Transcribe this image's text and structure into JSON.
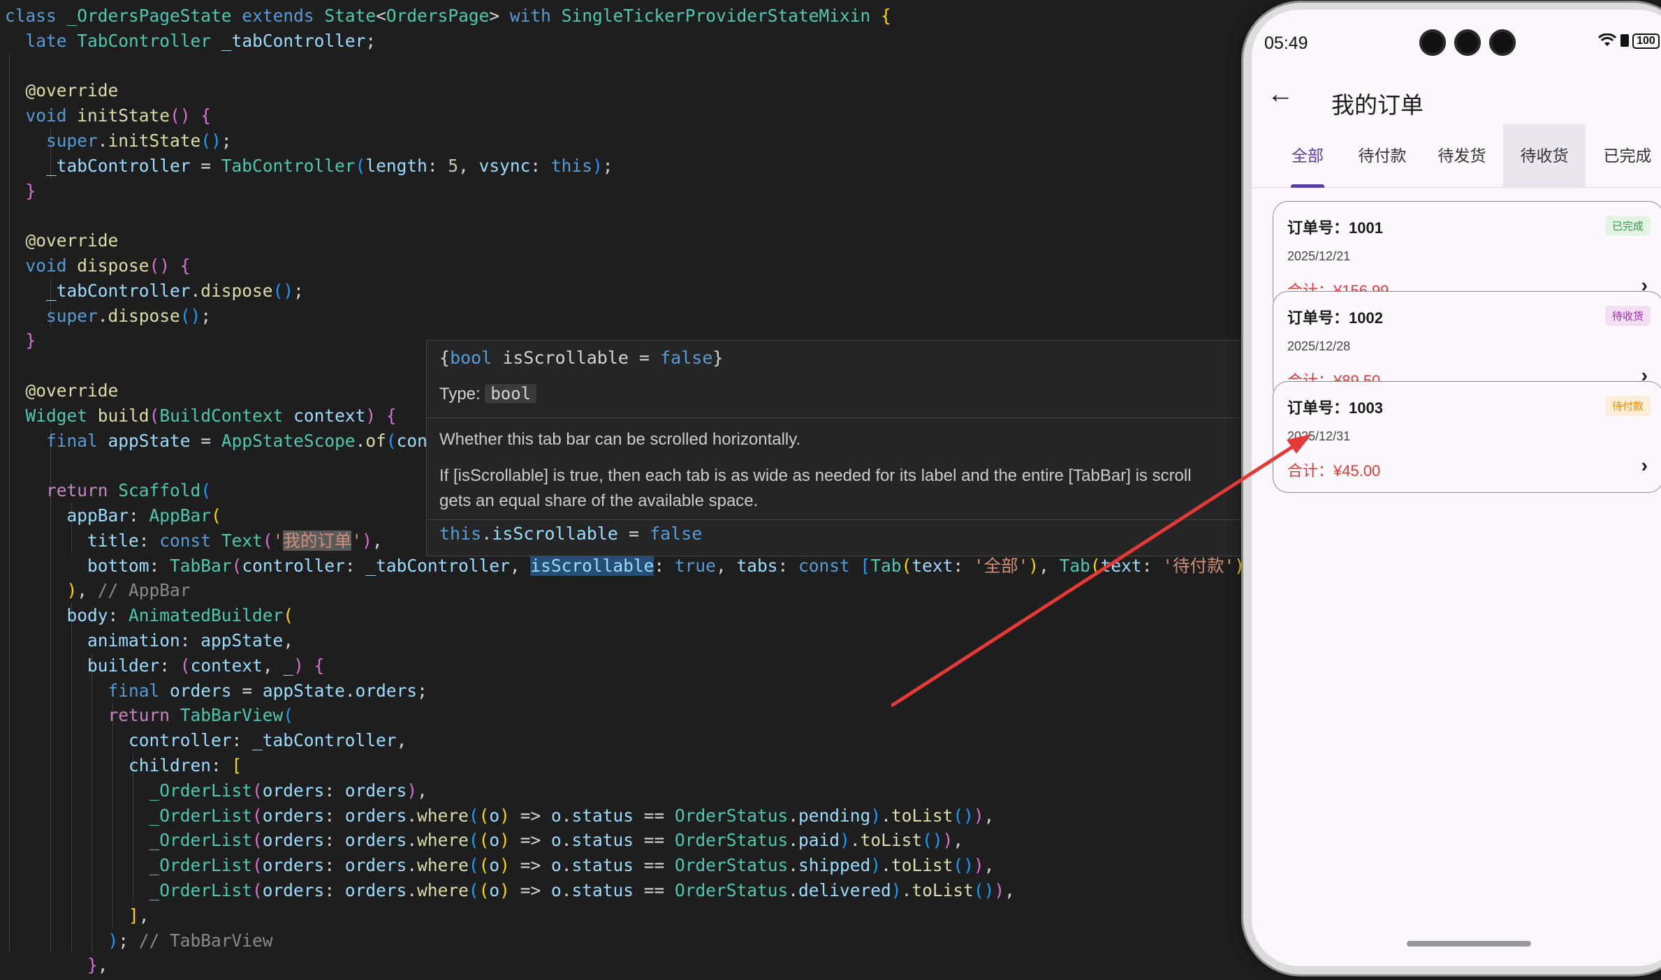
{
  "code_lines": [
    {
      "indent": "",
      "tokens": [
        [
          "kw",
          "class"
        ],
        [
          "pu",
          " "
        ],
        [
          "ty",
          "_OrdersPageState"
        ],
        [
          "pu",
          " "
        ],
        [
          "kw",
          "extends"
        ],
        [
          "pu",
          " "
        ],
        [
          "ty",
          "State"
        ],
        [
          "pu",
          "<"
        ],
        [
          "ty",
          "OrdersPage"
        ],
        [
          "pu",
          "> "
        ],
        [
          "kw",
          "with"
        ],
        [
          "pu",
          " "
        ],
        [
          "ty",
          "SingleTickerProviderStateMixin"
        ],
        [
          "pu",
          " "
        ],
        [
          "b1",
          "{"
        ]
      ]
    },
    {
      "indent": "  ",
      "tokens": [
        [
          "kw",
          "late"
        ],
        [
          "pu",
          " "
        ],
        [
          "ty",
          "TabController"
        ],
        [
          "pu",
          " "
        ],
        [
          "va",
          "_tabController"
        ],
        [
          "pu",
          ";"
        ]
      ]
    },
    {
      "indent": "",
      "tokens": []
    },
    {
      "indent": "  ",
      "tokens": [
        [
          "fn",
          "@override"
        ]
      ]
    },
    {
      "indent": "  ",
      "tokens": [
        [
          "kw",
          "void"
        ],
        [
          "pu",
          " "
        ],
        [
          "fn",
          "initState"
        ],
        [
          "b2",
          "()"
        ],
        [
          "pu",
          " "
        ],
        [
          "b2",
          "{"
        ]
      ]
    },
    {
      "indent": "    ",
      "tokens": [
        [
          "kw",
          "super"
        ],
        [
          "pu",
          "."
        ],
        [
          "fn",
          "initState"
        ],
        [
          "b3",
          "()"
        ],
        [
          "pu",
          ";"
        ]
      ]
    },
    {
      "indent": "    ",
      "tokens": [
        [
          "va",
          "_tabController"
        ],
        [
          "pu",
          " = "
        ],
        [
          "ty",
          "TabController"
        ],
        [
          "b3",
          "("
        ],
        [
          "va",
          "length"
        ],
        [
          "pu",
          ": "
        ],
        [
          "nu",
          "5"
        ],
        [
          "pu",
          ", "
        ],
        [
          "va",
          "vsync"
        ],
        [
          "pu",
          ": "
        ],
        [
          "kw",
          "this"
        ],
        [
          "b3",
          ")"
        ],
        [
          "pu",
          ";"
        ]
      ]
    },
    {
      "indent": "  ",
      "tokens": [
        [
          "b2",
          "}"
        ]
      ]
    },
    {
      "indent": "",
      "tokens": []
    },
    {
      "indent": "  ",
      "tokens": [
        [
          "fn",
          "@override"
        ]
      ]
    },
    {
      "indent": "  ",
      "tokens": [
        [
          "kw",
          "void"
        ],
        [
          "pu",
          " "
        ],
        [
          "fn",
          "dispose"
        ],
        [
          "b2",
          "()"
        ],
        [
          "pu",
          " "
        ],
        [
          "b2",
          "{"
        ]
      ]
    },
    {
      "indent": "    ",
      "tokens": [
        [
          "va",
          "_tabController"
        ],
        [
          "pu",
          "."
        ],
        [
          "fn",
          "dispose"
        ],
        [
          "b3",
          "()"
        ],
        [
          "pu",
          ";"
        ]
      ]
    },
    {
      "indent": "    ",
      "tokens": [
        [
          "kw",
          "super"
        ],
        [
          "pu",
          "."
        ],
        [
          "fn",
          "dispose"
        ],
        [
          "b3",
          "()"
        ],
        [
          "pu",
          ";"
        ]
      ]
    },
    {
      "indent": "  ",
      "tokens": [
        [
          "b2",
          "}"
        ]
      ]
    },
    {
      "indent": "",
      "tokens": []
    },
    {
      "indent": "  ",
      "tokens": [
        [
          "fn",
          "@override"
        ]
      ]
    },
    {
      "indent": "  ",
      "tokens": [
        [
          "ty",
          "Widget"
        ],
        [
          "pu",
          " "
        ],
        [
          "fn",
          "build"
        ],
        [
          "b2",
          "("
        ],
        [
          "ty",
          "BuildContext"
        ],
        [
          "pu",
          " "
        ],
        [
          "va",
          "context"
        ],
        [
          "b2",
          ")"
        ],
        [
          "pu",
          " "
        ],
        [
          "b2",
          "{"
        ]
      ]
    },
    {
      "indent": "    ",
      "tokens": [
        [
          "kw",
          "final"
        ],
        [
          "pu",
          " "
        ],
        [
          "va",
          "appState"
        ],
        [
          "pu",
          " = "
        ],
        [
          "ty",
          "AppStateScope"
        ],
        [
          "pu",
          "."
        ],
        [
          "fn",
          "of"
        ],
        [
          "b3",
          "("
        ],
        [
          "va",
          "cont"
        ]
      ]
    },
    {
      "indent": "",
      "tokens": []
    },
    {
      "indent": "    ",
      "tokens": [
        [
          "kw2",
          "return"
        ],
        [
          "pu",
          " "
        ],
        [
          "ty",
          "Scaffold"
        ],
        [
          "b3",
          "("
        ]
      ]
    },
    {
      "indent": "      ",
      "tokens": [
        [
          "va",
          "appBar"
        ],
        [
          "pu",
          ": "
        ],
        [
          "ty",
          "AppBar"
        ],
        [
          "b1",
          "("
        ]
      ]
    },
    {
      "indent": "        ",
      "tokens": [
        [
          "va",
          "title"
        ],
        [
          "pu",
          ": "
        ],
        [
          "kw",
          "const"
        ],
        [
          "pu",
          " "
        ],
        [
          "ty",
          "Text"
        ],
        [
          "b2",
          "("
        ],
        [
          "st",
          "'"
        ],
        [
          "st hl",
          "我的订单"
        ],
        [
          "st",
          "'"
        ],
        [
          "b2",
          ")"
        ],
        [
          "pu",
          ","
        ]
      ]
    },
    {
      "indent": "        ",
      "tokens": [
        [
          "va",
          "bottom"
        ],
        [
          "pu",
          ": "
        ],
        [
          "ty",
          "TabBar"
        ],
        [
          "b2",
          "("
        ],
        [
          "va",
          "controller"
        ],
        [
          "pu",
          ": "
        ],
        [
          "va",
          "_tabController"
        ],
        [
          "pu",
          ", "
        ],
        [
          "va hl2",
          "isScrollable"
        ],
        [
          "pu",
          ": "
        ],
        [
          "kw",
          "true"
        ],
        [
          "pu",
          ", "
        ],
        [
          "va",
          "tabs"
        ],
        [
          "pu",
          ": "
        ],
        [
          "kw",
          "const"
        ],
        [
          "pu",
          " "
        ],
        [
          "b3",
          "["
        ],
        [
          "ty",
          "Tab"
        ],
        [
          "b1",
          "("
        ],
        [
          "va",
          "text"
        ],
        [
          "pu",
          ": "
        ],
        [
          "st",
          "'全部'"
        ],
        [
          "b1",
          ")"
        ],
        [
          "pu",
          ", "
        ],
        [
          "ty",
          "Tab"
        ],
        [
          "b1",
          "("
        ],
        [
          "va",
          "text"
        ],
        [
          "pu",
          ": "
        ],
        [
          "st",
          "'待付款'"
        ],
        [
          "b1",
          ")"
        ],
        [
          "pu",
          ", "
        ]
      ]
    },
    {
      "indent": "      ",
      "tokens": [
        [
          "b1",
          ")"
        ],
        [
          "pu",
          ", "
        ],
        [
          "cm",
          "// AppBar"
        ]
      ]
    },
    {
      "indent": "      ",
      "tokens": [
        [
          "va",
          "body"
        ],
        [
          "pu",
          ": "
        ],
        [
          "ty",
          "AnimatedBuilder"
        ],
        [
          "b1",
          "("
        ]
      ]
    },
    {
      "indent": "        ",
      "tokens": [
        [
          "va",
          "animation"
        ],
        [
          "pu",
          ": "
        ],
        [
          "va",
          "appState"
        ],
        [
          "pu",
          ","
        ]
      ]
    },
    {
      "indent": "        ",
      "tokens": [
        [
          "va",
          "builder"
        ],
        [
          "pu",
          ": "
        ],
        [
          "b2",
          "("
        ],
        [
          "va",
          "context"
        ],
        [
          "pu",
          ", "
        ],
        [
          "va",
          "_"
        ],
        [
          "b2",
          ")"
        ],
        [
          "pu",
          " "
        ],
        [
          "b2",
          "{"
        ]
      ]
    },
    {
      "indent": "          ",
      "tokens": [
        [
          "kw",
          "final"
        ],
        [
          "pu",
          " "
        ],
        [
          "va",
          "orders"
        ],
        [
          "pu",
          " = "
        ],
        [
          "va",
          "appState"
        ],
        [
          "pu",
          "."
        ],
        [
          "va",
          "orders"
        ],
        [
          "pu",
          ";"
        ]
      ]
    },
    {
      "indent": "          ",
      "tokens": [
        [
          "kw2",
          "return"
        ],
        [
          "pu",
          " "
        ],
        [
          "ty",
          "TabBarView"
        ],
        [
          "b3",
          "("
        ]
      ]
    },
    {
      "indent": "            ",
      "tokens": [
        [
          "va",
          "controller"
        ],
        [
          "pu",
          ": "
        ],
        [
          "va",
          "_tabController"
        ],
        [
          "pu",
          ","
        ]
      ]
    },
    {
      "indent": "            ",
      "tokens": [
        [
          "va",
          "children"
        ],
        [
          "pu",
          ": "
        ],
        [
          "b1",
          "["
        ]
      ]
    },
    {
      "indent": "              ",
      "tokens": [
        [
          "ty",
          "_OrderList"
        ],
        [
          "b2",
          "("
        ],
        [
          "va",
          "orders"
        ],
        [
          "pu",
          ": "
        ],
        [
          "va",
          "orders"
        ],
        [
          "b2",
          ")"
        ],
        [
          "pu",
          ","
        ]
      ]
    },
    {
      "indent": "              ",
      "tokens": [
        [
          "ty",
          "_OrderList"
        ],
        [
          "b2",
          "("
        ],
        [
          "va",
          "orders"
        ],
        [
          "pu",
          ": "
        ],
        [
          "va",
          "orders"
        ],
        [
          "pu",
          "."
        ],
        [
          "fn",
          "where"
        ],
        [
          "b3",
          "("
        ],
        [
          "b1",
          "("
        ],
        [
          "va",
          "o"
        ],
        [
          "b1",
          ")"
        ],
        [
          "pu",
          " => "
        ],
        [
          "va",
          "o"
        ],
        [
          "pu",
          "."
        ],
        [
          "va",
          "status"
        ],
        [
          "pu",
          " == "
        ],
        [
          "ty",
          "OrderStatus"
        ],
        [
          "pu",
          "."
        ],
        [
          "va",
          "pending"
        ],
        [
          "b3",
          ")"
        ],
        [
          "pu",
          "."
        ],
        [
          "fn",
          "toList"
        ],
        [
          "b3",
          "()"
        ],
        [
          "b2",
          ")"
        ],
        [
          "pu",
          ","
        ]
      ]
    },
    {
      "indent": "              ",
      "tokens": [
        [
          "ty",
          "_OrderList"
        ],
        [
          "b2",
          "("
        ],
        [
          "va",
          "orders"
        ],
        [
          "pu",
          ": "
        ],
        [
          "va",
          "orders"
        ],
        [
          "pu",
          "."
        ],
        [
          "fn",
          "where"
        ],
        [
          "b3",
          "("
        ],
        [
          "b1",
          "("
        ],
        [
          "va",
          "o"
        ],
        [
          "b1",
          ")"
        ],
        [
          "pu",
          " => "
        ],
        [
          "va",
          "o"
        ],
        [
          "pu",
          "."
        ],
        [
          "va",
          "status"
        ],
        [
          "pu",
          " == "
        ],
        [
          "ty",
          "OrderStatus"
        ],
        [
          "pu",
          "."
        ],
        [
          "va",
          "paid"
        ],
        [
          "b3",
          ")"
        ],
        [
          "pu",
          "."
        ],
        [
          "fn",
          "toList"
        ],
        [
          "b3",
          "()"
        ],
        [
          "b2",
          ")"
        ],
        [
          "pu",
          ","
        ]
      ]
    },
    {
      "indent": "              ",
      "tokens": [
        [
          "ty",
          "_OrderList"
        ],
        [
          "b2",
          "("
        ],
        [
          "va",
          "orders"
        ],
        [
          "pu",
          ": "
        ],
        [
          "va",
          "orders"
        ],
        [
          "pu",
          "."
        ],
        [
          "fn",
          "where"
        ],
        [
          "b3",
          "("
        ],
        [
          "b1",
          "("
        ],
        [
          "va",
          "o"
        ],
        [
          "b1",
          ")"
        ],
        [
          "pu",
          " => "
        ],
        [
          "va",
          "o"
        ],
        [
          "pu",
          "."
        ],
        [
          "va",
          "status"
        ],
        [
          "pu",
          " == "
        ],
        [
          "ty",
          "OrderStatus"
        ],
        [
          "pu",
          "."
        ],
        [
          "va",
          "shipped"
        ],
        [
          "b3",
          ")"
        ],
        [
          "pu",
          "."
        ],
        [
          "fn",
          "toList"
        ],
        [
          "b3",
          "()"
        ],
        [
          "b2",
          ")"
        ],
        [
          "pu",
          ","
        ]
      ]
    },
    {
      "indent": "              ",
      "tokens": [
        [
          "ty",
          "_OrderList"
        ],
        [
          "b2",
          "("
        ],
        [
          "va",
          "orders"
        ],
        [
          "pu",
          ": "
        ],
        [
          "va",
          "orders"
        ],
        [
          "pu",
          "."
        ],
        [
          "fn",
          "where"
        ],
        [
          "b3",
          "("
        ],
        [
          "b1",
          "("
        ],
        [
          "va",
          "o"
        ],
        [
          "b1",
          ")"
        ],
        [
          "pu",
          " => "
        ],
        [
          "va",
          "o"
        ],
        [
          "pu",
          "."
        ],
        [
          "va",
          "status"
        ],
        [
          "pu",
          " == "
        ],
        [
          "ty",
          "OrderStatus"
        ],
        [
          "pu",
          "."
        ],
        [
          "va",
          "delivered"
        ],
        [
          "b3",
          ")"
        ],
        [
          "pu",
          "."
        ],
        [
          "fn",
          "toList"
        ],
        [
          "b3",
          "()"
        ],
        [
          "b2",
          ")"
        ],
        [
          "pu",
          ","
        ]
      ]
    },
    {
      "indent": "            ",
      "tokens": [
        [
          "b1",
          "]"
        ],
        [
          "pu",
          ","
        ]
      ]
    },
    {
      "indent": "          ",
      "tokens": [
        [
          "b3",
          ")"
        ],
        [
          "pu",
          "; "
        ],
        [
          "cm",
          "// TabBarView"
        ]
      ]
    },
    {
      "indent": "        ",
      "tokens": [
        [
          "b2",
          "}"
        ],
        [
          "pu",
          ","
        ]
      ]
    }
  ],
  "tooltip": {
    "signature": [
      [
        "pu",
        "{"
      ],
      [
        "kw",
        "bool"
      ],
      [
        "pu",
        " isScrollable = "
      ],
      [
        "kw",
        "false"
      ],
      [
        "pu",
        "}"
      ]
    ],
    "type_label": "Type:",
    "type_value": "bool",
    "desc1": "Whether this tab bar can be scrolled horizontally.",
    "desc2_line1": "If [isScrollable] is true, then each tab is as wide as needed for its label and the entire [TabBar] is scroll",
    "desc2_line2": "gets an equal share of the available space.",
    "assign": [
      [
        "kw",
        "this"
      ],
      [
        "pu",
        "."
      ],
      [
        "va",
        "isScrollable"
      ],
      [
        "pu",
        " = "
      ],
      [
        "kw",
        "false"
      ]
    ]
  },
  "phone": {
    "status_time": "05:49",
    "battery": "100",
    "back_glyph": "←",
    "title": "我的订单",
    "tabs": [
      "全部",
      "待付款",
      "待发货",
      "待收货",
      "已完成"
    ],
    "active_tab": "全部",
    "hovered_tab": "待收货",
    "orders": [
      {
        "number": "订单号：1001",
        "date": "2025/12/21",
        "total": "合计：¥156.99",
        "status": "已完成",
        "status_color": "#2e9a43",
        "status_bg": "#e3f4e4"
      },
      {
        "number": "订单号：1002",
        "date": "2025/12/28",
        "total": "合计：¥89.50",
        "status": "待收货",
        "status_color": "#9c27b0",
        "status_bg": "#f1dff3"
      },
      {
        "number": "订单号：1003",
        "date": "2025/12/31",
        "total": "合计：¥45.00",
        "status": "待付款",
        "status_color": "#ef8a00",
        "status_bg": "#fdeeda"
      }
    ],
    "chevron": "›"
  },
  "colors": {
    "annotation_arrow": "#e53935",
    "accent": "#5b3fa0",
    "price_red": "#e53935"
  }
}
